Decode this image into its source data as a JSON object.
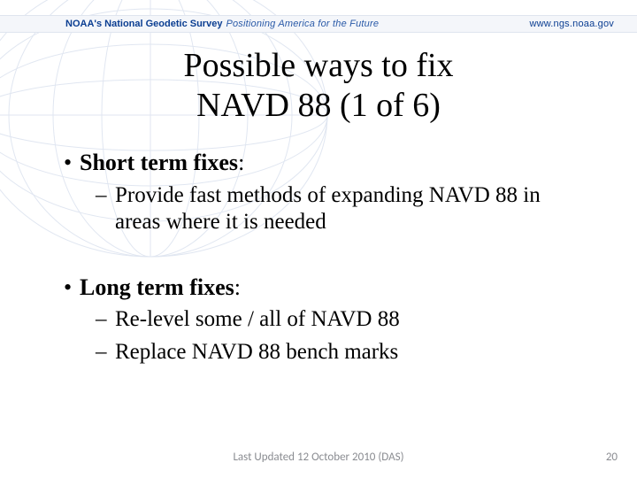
{
  "header": {
    "brand": "NOAA's National Geodetic Survey",
    "tagline": "Positioning America for the Future",
    "url": "www.ngs.noaa.gov"
  },
  "title_line1": "Possible ways to fix",
  "title_line2": "NAVD 88 (1 of 6)",
  "bullets": [
    {
      "label": "Short term fixes",
      "subitems": [
        "Provide fast methods of expanding NAVD 88 in areas where it is needed"
      ]
    },
    {
      "label": "Long term fixes",
      "subitems": [
        "Re-level some / all of NAVD 88",
        "Replace NAVD 88 bench marks"
      ]
    }
  ],
  "footer": {
    "updated": "Last Updated 12 October 2010 (DAS)",
    "page": "20"
  }
}
